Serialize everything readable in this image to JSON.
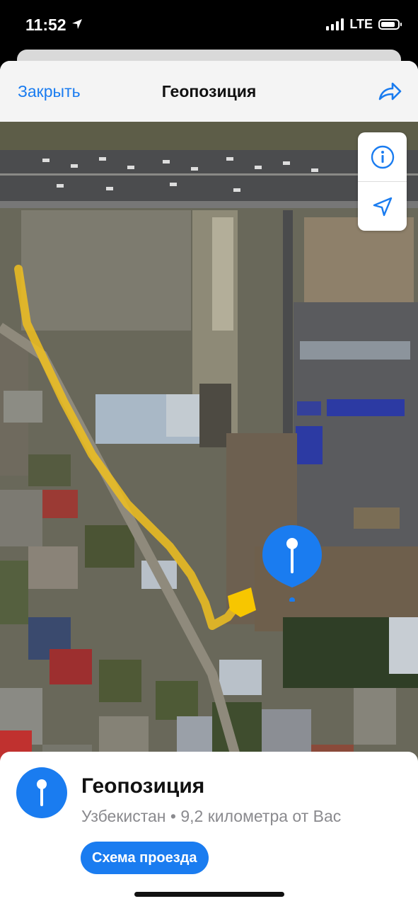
{
  "status_bar": {
    "time": "11:52",
    "network": "LTE",
    "signal_bars": 4,
    "battery_level": 0.85,
    "location_icon": "location-arrow-icon"
  },
  "nav": {
    "close_label": "Закрыть",
    "title": "Геопозиция",
    "share_icon": "share-icon"
  },
  "map": {
    "type": "satellite",
    "controls": [
      "info-icon",
      "location-arrow-icon"
    ],
    "pin_icon": "map-pin-icon",
    "route_color": "#f1c40f",
    "accent": "#1a7cf0"
  },
  "place": {
    "title": "Геопозиция",
    "country": "Узбекистан",
    "separator": "•",
    "distance": "9,2 километра от Вас",
    "directions_label": "Схема проезда"
  }
}
